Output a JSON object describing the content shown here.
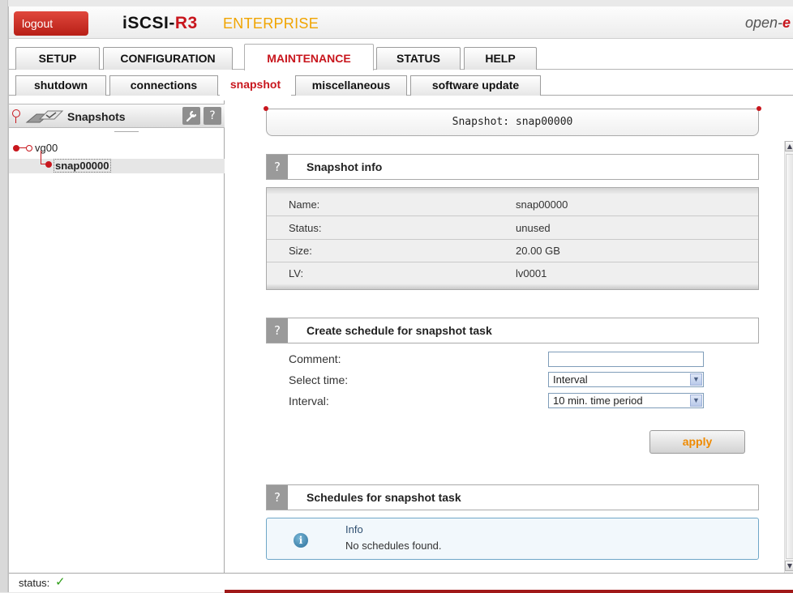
{
  "header": {
    "logout_label": "logout",
    "brand_prefix": "iSCSI-",
    "brand_suffix": "R3",
    "edition": "ENTERPRISE",
    "vendor_prefix": "open-",
    "vendor_suffix": "e"
  },
  "main_tabs": [
    {
      "label": "SETUP",
      "active": false
    },
    {
      "label": "CONFIGURATION",
      "active": false
    },
    {
      "label": "MAINTENANCE",
      "active": true
    },
    {
      "label": "STATUS",
      "active": false
    },
    {
      "label": "HELP",
      "active": false
    }
  ],
  "sub_tabs": [
    {
      "label": "shutdown",
      "active": false
    },
    {
      "label": "connections",
      "active": false
    },
    {
      "label": "snapshot",
      "active": true
    },
    {
      "label": "miscellaneous",
      "active": false
    },
    {
      "label": "software update",
      "active": false
    }
  ],
  "tree": {
    "title": "Snapshots",
    "tool_icon": "wrench-icon",
    "help_label": "?",
    "nodes": [
      {
        "label": "vg00",
        "level": 0
      },
      {
        "label": "snap00000",
        "level": 1,
        "selected": true
      }
    ]
  },
  "page_title": "Snapshot: snap00000",
  "snapshot_info": {
    "help_label": "?",
    "title": "Snapshot info",
    "rows": [
      {
        "key": "Name:",
        "value": "snap00000"
      },
      {
        "key": "Status:",
        "value": "unused"
      },
      {
        "key": "Size:",
        "value": "20.00 GB"
      },
      {
        "key": "LV:",
        "value": "lv0001"
      }
    ]
  },
  "schedule_form": {
    "help_label": "?",
    "title": "Create schedule for snapshot task",
    "comment_label": "Comment:",
    "comment_value": "",
    "select_time_label": "Select time:",
    "select_time_value": "Interval",
    "interval_label": "Interval:",
    "interval_value": "10 min. time period",
    "apply_label": "apply"
  },
  "schedules": {
    "help_label": "?",
    "title": "Schedules for snapshot task",
    "info_title": "Info",
    "info_message": "No schedules found."
  },
  "status_bar": {
    "label": "status:",
    "check": "✓"
  },
  "colors": {
    "accent_red": "#c8161d",
    "edition_orange": "#f0a400",
    "apply_orange": "#ef8a00",
    "status_green": "#2e9d18"
  }
}
